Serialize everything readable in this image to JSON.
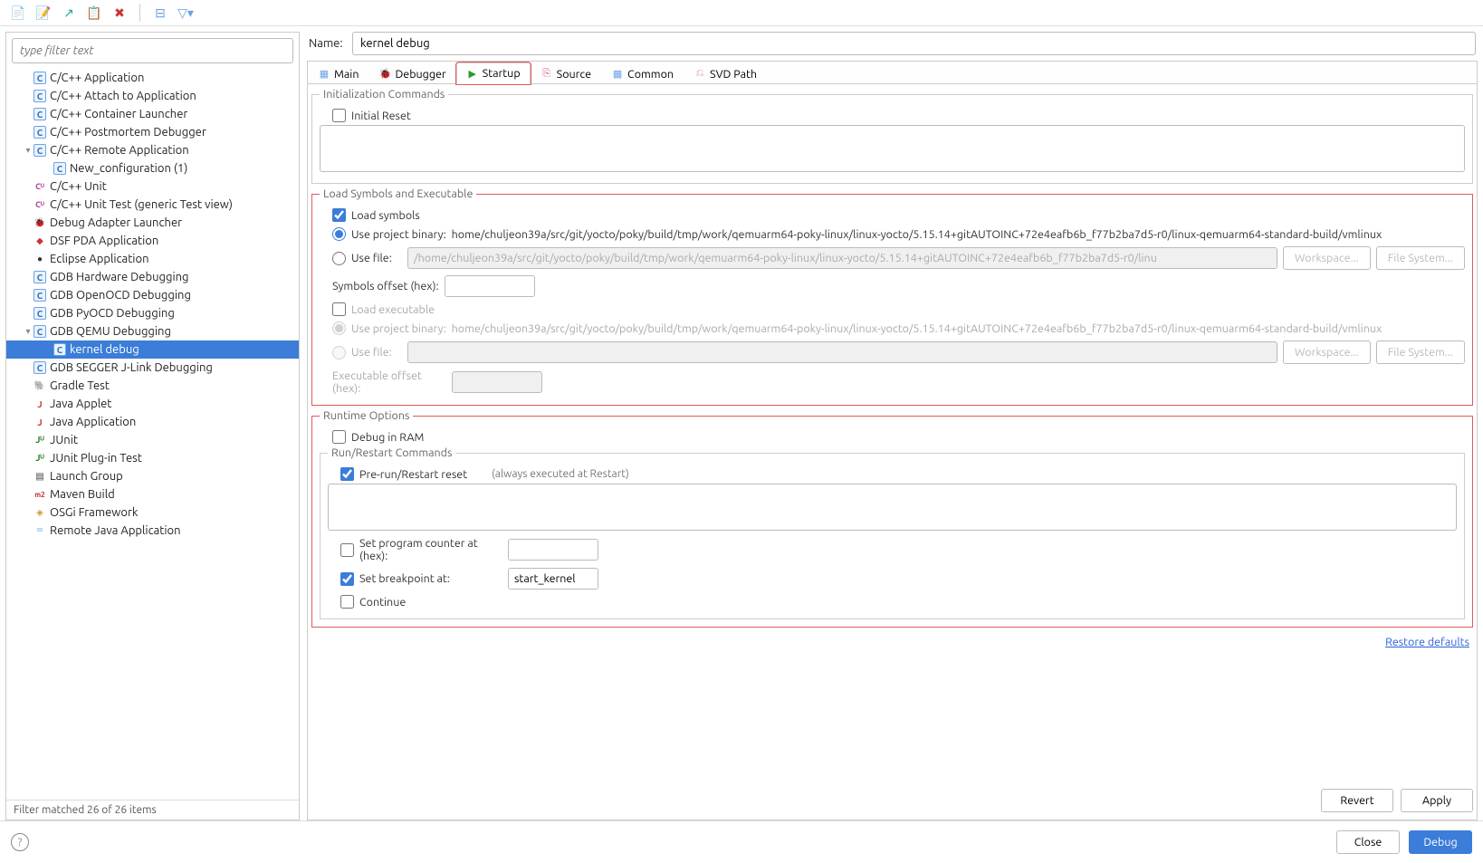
{
  "filter_placeholder": "type filter text",
  "name_label": "Name:",
  "name_value": "kernel debug",
  "toolbar_icons": [
    "new",
    "clone",
    "import",
    "export",
    "delete",
    "collapse",
    "filter"
  ],
  "tree": [
    {
      "i": "c",
      "t": "C/C++ Application",
      "d": 1
    },
    {
      "i": "c",
      "t": "C/C++ Attach to Application",
      "d": 1
    },
    {
      "i": "c",
      "t": "C/C++ Container Launcher",
      "d": 1
    },
    {
      "i": "c",
      "t": "C/C++ Postmortem Debugger",
      "d": 1
    },
    {
      "i": "c",
      "t": "C/C++ Remote Application",
      "d": 1,
      "exp": true
    },
    {
      "i": "c",
      "t": "New_configuration (1)",
      "d": 2
    },
    {
      "i": "cu",
      "t": "C/C++ Unit",
      "d": 1
    },
    {
      "i": "cu",
      "t": "C/C++ Unit Test (generic Test view)",
      "d": 1
    },
    {
      "i": "bug",
      "t": "Debug Adapter Launcher",
      "d": 1
    },
    {
      "i": "dsf",
      "t": "DSF PDA Application",
      "d": 1
    },
    {
      "i": "ecl",
      "t": "Eclipse Application",
      "d": 1
    },
    {
      "i": "c",
      "t": "GDB Hardware Debugging",
      "d": 1
    },
    {
      "i": "c",
      "t": "GDB OpenOCD Debugging",
      "d": 1
    },
    {
      "i": "c",
      "t": "GDB PyOCD Debugging",
      "d": 1
    },
    {
      "i": "c",
      "t": "GDB QEMU Debugging",
      "d": 1,
      "exp": true
    },
    {
      "i": "c",
      "t": "kernel debug",
      "d": 2,
      "sel": true
    },
    {
      "i": "c",
      "t": "GDB SEGGER J-Link Debugging",
      "d": 1
    },
    {
      "i": "grd",
      "t": "Gradle Test",
      "d": 1
    },
    {
      "i": "java",
      "t": "Java Applet",
      "d": 1
    },
    {
      "i": "java",
      "t": "Java Application",
      "d": 1
    },
    {
      "i": "ju",
      "t": "JUnit",
      "d": 1
    },
    {
      "i": "ju",
      "t": "JUnit Plug-in Test",
      "d": 1
    },
    {
      "i": "lg",
      "t": "Launch Group",
      "d": 1
    },
    {
      "i": "mvn",
      "t": "Maven Build",
      "d": 1
    },
    {
      "i": "osgi",
      "t": "OSGi Framework",
      "d": 1
    },
    {
      "i": "rj",
      "t": "Remote Java Application",
      "d": 1
    }
  ],
  "filter_status": "Filter matched 26 of 26 items",
  "tabs": [
    {
      "id": "main",
      "label": "Main"
    },
    {
      "id": "debugger",
      "label": "Debugger"
    },
    {
      "id": "startup",
      "label": "Startup",
      "active": true,
      "hl": true
    },
    {
      "id": "source",
      "label": "Source"
    },
    {
      "id": "common",
      "label": "Common"
    },
    {
      "id": "svd",
      "label": "SVD Path"
    }
  ],
  "startup": {
    "init_title": "Initialization Commands",
    "initial_reset": "Initial Reset",
    "load_title": "Load Symbols and Executable",
    "load_symbols": "Load symbols",
    "use_proj_binary": "Use project binary:",
    "proj_binary_path": "home/chuljeon39a/src/git/yocto/poky/build/tmp/work/qemuarm64-poky-linux/linux-yocto/5.15.14+gitAUTOINC+72e4eafb6b_f77b2ba7d5-r0/linux-qemuarm64-standard-build/vmlinux",
    "use_file": "Use file:",
    "file_path_1": "/home/chuljeon39a/src/git/yocto/poky/build/tmp/work/qemuarm64-poky-linux/linux-yocto/5.15.14+gitAUTOINC+72e4eafb6b_f77b2ba7d5-r0/linu",
    "workspace_btn": "Workspace...",
    "filesystem_btn": "File System...",
    "sym_offset": "Symbols offset (hex):",
    "load_exec": "Load executable",
    "exec_proj_path": "home/chuljeon39a/src/git/yocto/poky/build/tmp/work/qemuarm64-poky-linux/linux-yocto/5.15.14+gitAUTOINC+72e4eafb6b_f77b2ba7d5-r0/linux-qemuarm64-standard-build/vmlinux",
    "exec_offset": "Executable offset (hex):",
    "runtime_title": "Runtime Options",
    "debug_ram": "Debug in RAM",
    "runrestart_title": "Run/Restart Commands",
    "prerun_reset": "Pre-run/Restart reset",
    "always_exec": "(always executed at Restart)",
    "set_pc": "Set program counter at (hex):",
    "set_bp": "Set breakpoint at:",
    "bp_value": "start_kernel",
    "continue": "Continue"
  },
  "restore_defaults": "Restore defaults",
  "revert": "Revert",
  "apply": "Apply",
  "close": "Close",
  "debug": "Debug"
}
